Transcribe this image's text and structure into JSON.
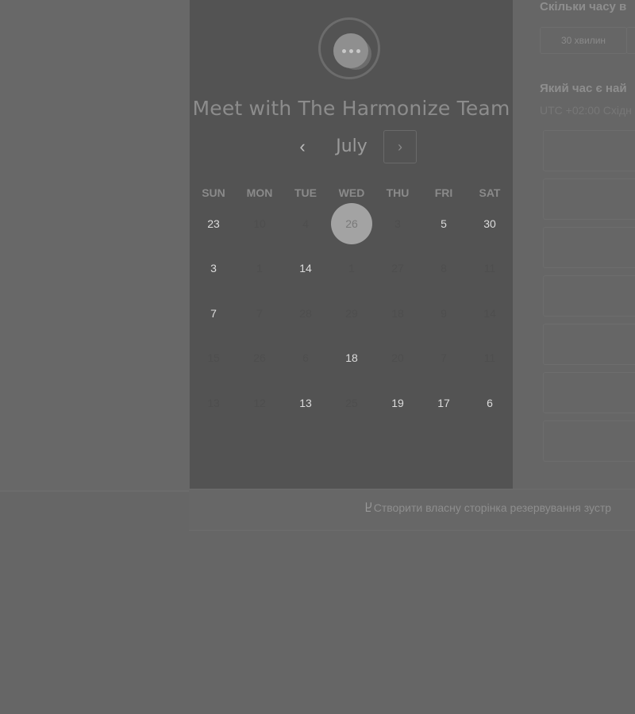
{
  "header": {
    "title": "Meet with The Harmonize Team",
    "logo_icon": "chat-bubble-icon"
  },
  "calendar": {
    "month": "July",
    "prev_icon": "‹",
    "next_icon": "›",
    "weekdays": [
      "SUN",
      "MON",
      "TUE",
      "WED",
      "THU",
      "FRI",
      "SAT"
    ],
    "weeks": [
      [
        {
          "d": "23",
          "on": true
        },
        {
          "d": "10",
          "on": false
        },
        {
          "d": "4",
          "on": false
        },
        {
          "d": "26",
          "on": false,
          "sel": true
        },
        {
          "d": "3",
          "on": false
        },
        {
          "d": "5",
          "on": true
        },
        {
          "d": "30",
          "on": true
        }
      ],
      [
        {
          "d": "3",
          "on": true
        },
        {
          "d": "1",
          "on": false
        },
        {
          "d": "14",
          "on": true
        },
        {
          "d": "1",
          "on": false
        },
        {
          "d": "27",
          "on": false
        },
        {
          "d": "8",
          "on": false
        },
        {
          "d": "11",
          "on": false
        }
      ],
      [
        {
          "d": "7",
          "on": true
        },
        {
          "d": "7",
          "on": false
        },
        {
          "d": "28",
          "on": false
        },
        {
          "d": "29",
          "on": false
        },
        {
          "d": "18",
          "on": false
        },
        {
          "d": "9",
          "on": false
        },
        {
          "d": "14",
          "on": false
        }
      ],
      [
        {
          "d": "15",
          "on": false
        },
        {
          "d": "26",
          "on": false
        },
        {
          "d": "6",
          "on": false
        },
        {
          "d": "18",
          "on": true
        },
        {
          "d": "20",
          "on": false
        },
        {
          "d": "7",
          "on": false
        },
        {
          "d": "11",
          "on": false
        }
      ],
      [
        {
          "d": "13",
          "on": false
        },
        {
          "d": "12",
          "on": false
        },
        {
          "d": "13",
          "on": true
        },
        {
          "d": "25",
          "on": false
        },
        {
          "d": "19",
          "on": true
        },
        {
          "d": "17",
          "on": true
        },
        {
          "d": "6",
          "on": true
        }
      ]
    ]
  },
  "right": {
    "duration_heading": "Скільки часу в",
    "duration_option": "30 хвилин",
    "time_heading": "Який час є най",
    "timezone": "UTC +02:00 Східн"
  },
  "footer": {
    "icon": "hubspot-sprocket-icon",
    "link_text": "Створити власну сторінка резервування зустр"
  },
  "colors": {
    "overlay_bg": "#666666",
    "panel_bg": "#535353",
    "selected_day": "#a3a3a3"
  }
}
